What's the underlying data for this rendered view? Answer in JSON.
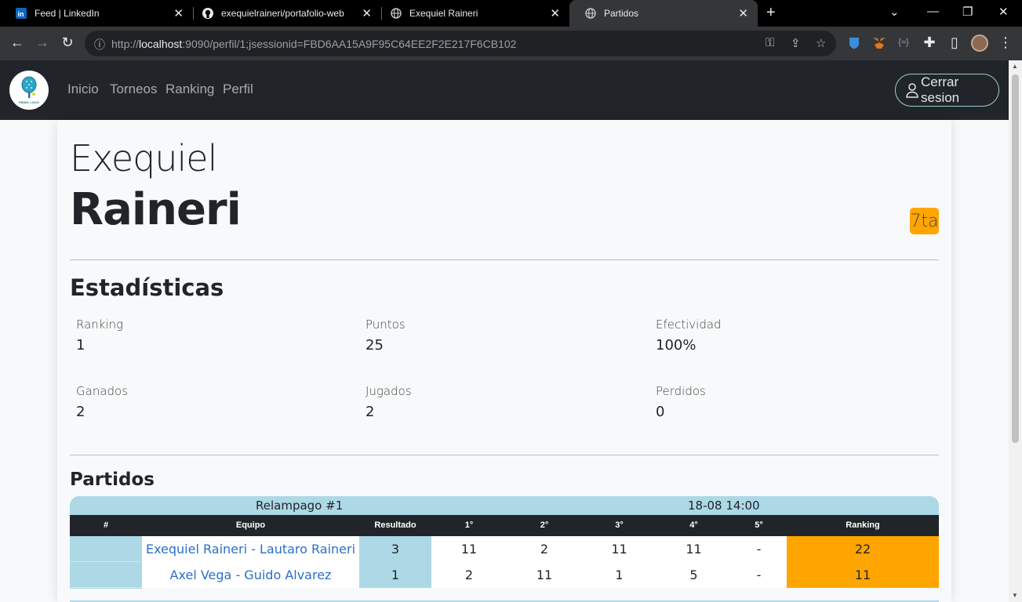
{
  "browser": {
    "tabs": [
      {
        "title": "Feed | LinkedIn",
        "icon": "linkedin-icon"
      },
      {
        "title": "exequielraineri/portafolio-web",
        "icon": "github-icon"
      },
      {
        "title": "Exequiel Raineri",
        "icon": "globe-icon"
      },
      {
        "title": "Partidos",
        "icon": "globe-icon",
        "active": true
      }
    ],
    "url_prefix": "http://",
    "url_host": "localhost",
    "url_rest": ":9090/perfil/1;jsessionid=FBD6AA15A9F95C64EE2F2E217F6CB102"
  },
  "navbar": {
    "links": [
      "Inicio",
      "Torneos",
      "Ranking",
      "Perfil"
    ],
    "logo_text": "PADEL LOCO",
    "logout": "Cerrar sesion"
  },
  "profile": {
    "first_name": "Exequiel",
    "last_name": "Raineri",
    "category": "7ta"
  },
  "stats": {
    "heading": "Estadísticas",
    "items": [
      {
        "label": "Ranking",
        "value": "1"
      },
      {
        "label": "Puntos",
        "value": "25"
      },
      {
        "label": "Efectividad",
        "value": "100%"
      },
      {
        "label": "Ganados",
        "value": "2"
      },
      {
        "label": "Jugados",
        "value": "2"
      },
      {
        "label": "Perdidos",
        "value": "0"
      }
    ]
  },
  "matches": {
    "heading": "Partidos",
    "match": {
      "tournament": "Relampago #1",
      "datetime": "18-08 14:00",
      "columns": [
        "#",
        "Equipo",
        "Resultado",
        "1°",
        "2°",
        "3°",
        "4°",
        "5°",
        "Ranking"
      ],
      "rows": [
        {
          "team": "Exequiel Raineri - Lautaro Raineri",
          "result": "3",
          "sets": [
            "11",
            "2",
            "11",
            "11",
            "-"
          ],
          "ranking": "22"
        },
        {
          "team": "Axel Vega - Guido Alvarez",
          "result": "1",
          "sets": [
            "2",
            "11",
            "1",
            "5",
            "-"
          ],
          "ranking": "11"
        }
      ]
    }
  },
  "colors": {
    "navbar_bg": "#212529",
    "match_header": "#add8e6",
    "ranking_cell": "#ffa500",
    "link": "#2a6fc9"
  }
}
